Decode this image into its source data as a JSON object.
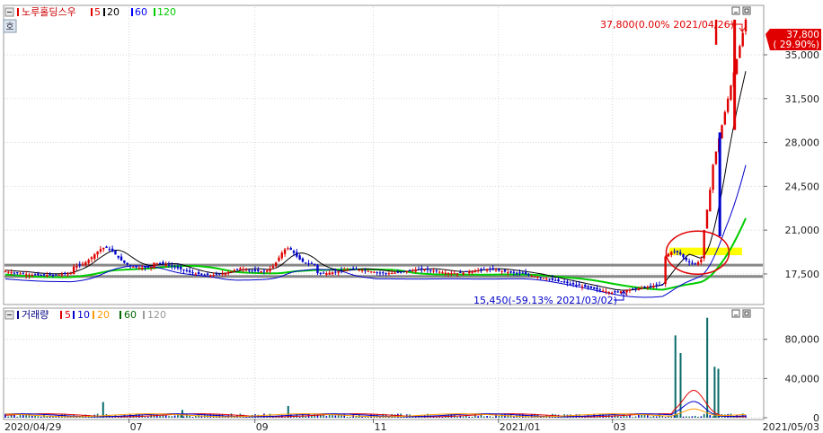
{
  "price_legend": {
    "name": "노루홀딩스우",
    "ma_labels": [
      "5",
      "20",
      "60",
      "120"
    ],
    "ma_colors": [
      "#e00000",
      "#000000",
      "#0000ff",
      "#00cc00"
    ]
  },
  "volume_legend": {
    "name": "거래량",
    "ma_labels": [
      "5",
      "10",
      "20",
      "60",
      "120"
    ],
    "ma_colors": [
      "#e00000",
      "#0000cc",
      "#ff9900",
      "#006600",
      "#999999"
    ]
  },
  "side_icon": "호",
  "annotations": {
    "high": "37,800(0.00% 2021/04/26)",
    "low": "15,450(-59.13% 2021/03/02)",
    "last_price": "37,800",
    "last_change": "( 29.90%)"
  },
  "colors": {
    "up": "#e00000",
    "down": "#0000cc",
    "hline": "#888888",
    "highlight": "#ffff00",
    "circle": "#e00000",
    "ma120": "#00cc00",
    "ma60": "#0000cc",
    "ma20": "#000000"
  },
  "chart_data": [
    {
      "type": "candlestick",
      "title": "노루홀딩스우",
      "y_ticks": [
        "17,500",
        "21,000",
        "24,500",
        "28,000",
        "31,500",
        "35,000"
      ],
      "y_tick_values": [
        17500,
        21000,
        24500,
        28000,
        31500,
        35000
      ],
      "ylim": [
        15200,
        38800
      ],
      "x_ticks": [
        "2020/04/29",
        "07",
        "09",
        "11",
        "2021/01",
        "03",
        "2021/05/03"
      ],
      "x_tick_values": [
        0,
        0.167,
        0.337,
        0.497,
        0.666,
        0.82,
        1.0
      ],
      "horizontal_lines": [
        18200,
        17300
      ],
      "highlight_band": [
        19000,
        19600
      ],
      "key_points": [
        {
          "date": "2021/03/02",
          "value": 15450
        },
        {
          "date": "2021/04/26",
          "value": 37800
        }
      ],
      "series": [
        {
          "name": "5",
          "kind": "line"
        },
        {
          "name": "20",
          "kind": "line"
        },
        {
          "name": "60",
          "kind": "line"
        },
        {
          "name": "120",
          "kind": "line"
        }
      ]
    },
    {
      "type": "bar",
      "title": "거래량",
      "y_ticks": [
        "0",
        "40,000",
        "80,000"
      ],
      "y_tick_values": [
        0,
        40000,
        80000
      ],
      "ylim": [
        0,
        110000
      ],
      "spikes": [
        {
          "x": 0.905,
          "value": 84000
        },
        {
          "x": 0.912,
          "value": 66000
        },
        {
          "x": 0.948,
          "value": 102000
        },
        {
          "x": 0.958,
          "value": 52000
        },
        {
          "x": 0.963,
          "value": 50000
        },
        {
          "x": 0.132,
          "value": 16000
        },
        {
          "x": 0.382,
          "value": 12000
        },
        {
          "x": 0.239,
          "value": 8000
        }
      ]
    }
  ]
}
